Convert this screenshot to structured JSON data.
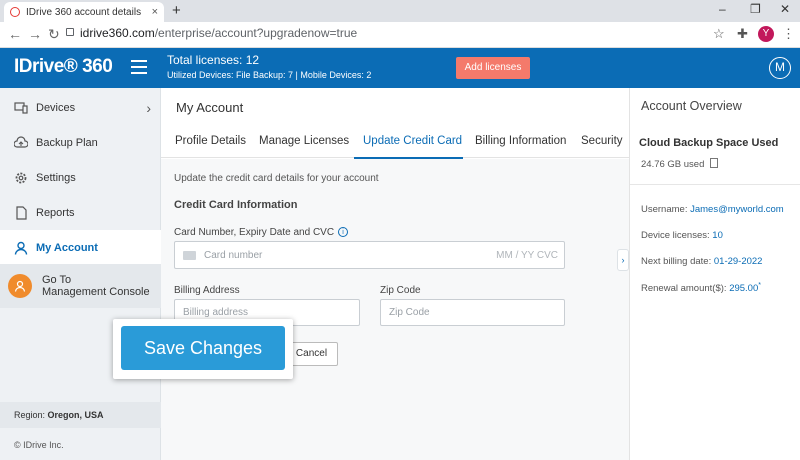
{
  "browser": {
    "tab_title": "IDrive 360 account details",
    "tab_close": "×",
    "new_tab": "+",
    "url_host": "idrive360.com",
    "url_path": "/enterprise/account?upgradenow=true",
    "profile_initial": "Y",
    "minimize": "–",
    "restore": "❐",
    "close": "✕",
    "back": "←",
    "forward": "→",
    "reload": "↻",
    "star": "☆",
    "extensions": "✚",
    "menu": "⋮"
  },
  "header": {
    "logo": "IDrive® 360",
    "total_licenses": "Total licenses: 12",
    "utilized": "Utilized Devices: File Backup: 7 |  Mobile Devices: 2",
    "add_licenses": "Add licenses",
    "user_initial": "M",
    "accent": "#0b6cb5"
  },
  "sidebar": {
    "items": [
      {
        "label": "Devices",
        "icon": "devices-icon"
      },
      {
        "label": "Backup Plan",
        "icon": "cloud-upload-icon"
      },
      {
        "label": "Settings",
        "icon": "gear-icon"
      },
      {
        "label": "Reports",
        "icon": "document-icon"
      },
      {
        "label": "My Account",
        "icon": "user-icon"
      }
    ],
    "chevron": "›",
    "mgmt_line1": "Go To",
    "mgmt_line2": "Management Console",
    "region_label": "Region: ",
    "region_value": "Oregon, USA",
    "copyright": "© IDrive Inc."
  },
  "main": {
    "title": "My Account",
    "tabs": [
      "Profile Details",
      "Manage Licenses",
      "Update Credit Card",
      "Billing Information",
      "Security"
    ],
    "active_tab": "Update Credit Card",
    "description": "Update the credit card details for your account",
    "section": "Credit Card Information",
    "card_label": "Card Number, Expiry Date and CVC",
    "info_icon": "i",
    "card_placeholder": "Card number",
    "card_suffix": "MM / YY  CVC",
    "billing_label": "Billing Address",
    "billing_placeholder": "Billing address",
    "zip_label": "Zip Code",
    "zip_placeholder": "Zip Code",
    "cancel": "Cancel",
    "save": "Save Changes",
    "collapse": "›"
  },
  "overview": {
    "title": "Account Overview",
    "cloud_heading": "Cloud  Backup Space Used",
    "used": "24.76 GB used",
    "username_label": "Username: ",
    "username_value": "James@myworld.com",
    "licenses_label": "Device licenses: ",
    "licenses_value": "10",
    "billing_label": "Next billing date: ",
    "billing_value": "01-29-2022",
    "renewal_label": "Renewal amount($): ",
    "renewal_value": "295.00",
    "renewal_mark": "*"
  }
}
